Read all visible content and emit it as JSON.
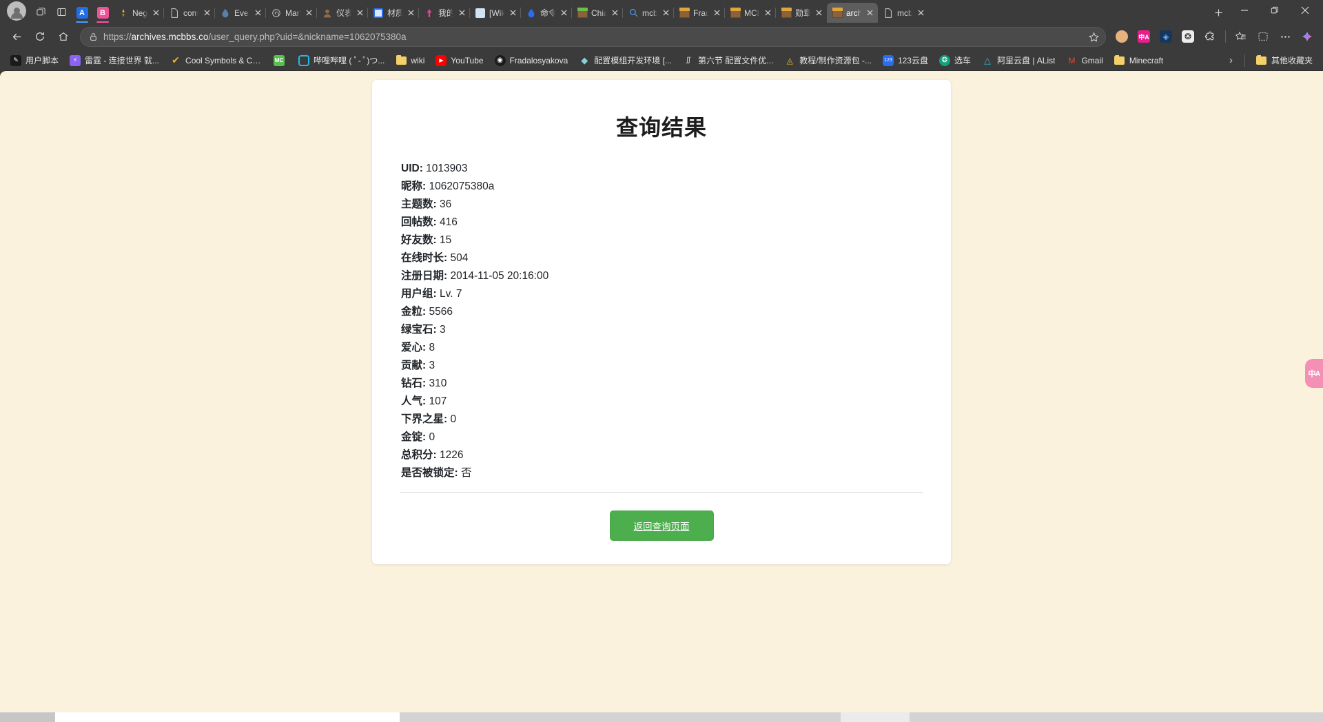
{
  "browser": {
    "window_controls": {
      "minimize": "—",
      "maximize": "❐",
      "close": "✕"
    },
    "new_tab_label": "+",
    "pinned_tabs": [
      {
        "name": "pinned-tab-a",
        "letter": "A",
        "color": "#1f6feb",
        "underline": "#4a9eff"
      },
      {
        "name": "pinned-tab-b",
        "letter": "B",
        "color": "#f0519a",
        "underline": "#ff4fa3"
      }
    ],
    "tabs": [
      {
        "title": "Negati",
        "icon": "compass-icon",
        "active": false
      },
      {
        "title": "com.p",
        "icon": "document-icon",
        "active": false
      },
      {
        "title": "Event",
        "icon": "droplet-icon",
        "active": false
      },
      {
        "title": "Marke",
        "icon": "spiral-icon",
        "active": false
      },
      {
        "title": "仪表盘",
        "icon": "person-icon",
        "active": false
      },
      {
        "title": "材质",
        "icon": "blue-square-icon",
        "active": false
      },
      {
        "title": "我的世",
        "icon": "pink-arrow-icon",
        "active": false
      },
      {
        "title": "[Wiki]",
        "icon": "wiki-icon",
        "active": false
      },
      {
        "title": "命令",
        "icon": "blue-droplet-icon",
        "active": false
      },
      {
        "title": "Chiang",
        "icon": "grass-block-icon",
        "active": false
      },
      {
        "title": "mcbbs",
        "icon": "search-icon",
        "active": false
      },
      {
        "title": "Frada",
        "icon": "dirt-block-icon",
        "active": false
      },
      {
        "title": "MCBB",
        "icon": "dirt-block-icon",
        "active": false
      },
      {
        "title": "勋章惨",
        "icon": "dirt-block-icon",
        "active": false
      },
      {
        "title": "archive",
        "icon": "dirt-block-icon",
        "active": true
      },
      {
        "title": "mcbbs",
        "icon": "document-icon",
        "active": false
      }
    ],
    "nav": {
      "back": "back-arrow",
      "refresh": "refresh-arrow",
      "home": "home-icon",
      "url_prefix": "https://",
      "url_domain": "archives.mcbbs.co",
      "url_path": "/user_query.php?uid=&nickname=1062075380a",
      "url_full": "https://archives.mcbbs.co/user_query.php?uid=&nickname=1062075380a",
      "lock": "lock-icon",
      "star": "favorite-star-icon"
    },
    "toolbar_icons": [
      {
        "name": "profile-face-icon",
        "glyph": "◕",
        "color": "#e8b27e"
      },
      {
        "name": "translate-icon",
        "glyph": "中A",
        "color": "#e91e8c"
      },
      {
        "name": "copilot-page-icon",
        "glyph": "◈",
        "color": "#2b5ea8"
      },
      {
        "name": "openai-icon",
        "glyph": "❂",
        "color": "#e8e8e8"
      },
      {
        "name": "extensions-icon",
        "glyph": "⧉",
        "color": "#dcdcdc"
      },
      {
        "name": "collections-icon",
        "glyph": "☆",
        "color": "#dcdcdc"
      },
      {
        "name": "split-screen-icon",
        "glyph": "⊠",
        "color": "#dcdcdc"
      },
      {
        "name": "settings-more-icon",
        "glyph": "⋯",
        "color": "#dcdcdc"
      },
      {
        "name": "copilot-icon",
        "glyph": "✦",
        "color": "#7cc6f7"
      }
    ],
    "bookmarks": [
      {
        "label": "用户脚本",
        "icon": "tampermonkey-icon",
        "color": "#1b1b1b"
      },
      {
        "label": "雷霆 - 连接世界 就...",
        "icon": "thunder-icon",
        "color": "#8a64f0"
      },
      {
        "label": "Cool Symbols & Co...",
        "icon": "check-icon",
        "color": "#f0b429"
      },
      {
        "label": "",
        "icon": "mc-icon",
        "color": "#5bbf4f"
      },
      {
        "label": "哔哩哔哩 ( ﾟ- ﾟ)つ...",
        "icon": "bilibili-icon",
        "color": "#22bbe8"
      },
      {
        "label": "wiki",
        "icon": "folder-icon",
        "color": "#f4d06a"
      },
      {
        "label": "YouTube",
        "icon": "youtube-icon",
        "color": "#ff0000"
      },
      {
        "label": "Fradalosyakova",
        "icon": "circle-icon",
        "color": "#1b1b1b"
      },
      {
        "label": "配置模组开发环境 [...",
        "icon": "diamond-icon",
        "color": "#8ad0d8"
      },
      {
        "label": "第六节 配置文件优...",
        "icon": "nn-icon",
        "color": "#dcdcdc"
      },
      {
        "label": "教程/制作资源包 -...",
        "icon": "palette-icon",
        "color": "#f0b429"
      },
      {
        "label": "123云盘",
        "icon": "cloud123-icon",
        "color": "#2a6df0"
      },
      {
        "label": "选车",
        "icon": "openai-icon",
        "color": "#10a37f"
      },
      {
        "label": "阿里云盘 | AList",
        "icon": "alist-icon",
        "color": "#36b0c9"
      },
      {
        "label": "Gmail",
        "icon": "gmail-icon",
        "color": "#ea4335"
      },
      {
        "label": "Minecraft",
        "icon": "folder-icon",
        "color": "#f4d06a"
      }
    ],
    "bookmarks_overflow": {
      "chevron": "›",
      "label": "其他收藏夹",
      "icon": "folder-icon"
    }
  },
  "page": {
    "title": "查询结果",
    "fields": [
      {
        "key": "UID",
        "value": "1013903"
      },
      {
        "key": "昵称",
        "value": "1062075380a"
      },
      {
        "key": "主题数",
        "value": "36"
      },
      {
        "key": "回帖数",
        "value": "416"
      },
      {
        "key": "好友数",
        "value": "15"
      },
      {
        "key": "在线时长",
        "value": "504"
      },
      {
        "key": "注册日期",
        "value": "2014-11-05 20:16:00"
      },
      {
        "key": "用户组",
        "value": "Lv. 7"
      },
      {
        "key": "金粒",
        "value": "5566"
      },
      {
        "key": "绿宝石",
        "value": "3"
      },
      {
        "key": "爱心",
        "value": "8"
      },
      {
        "key": "贡献",
        "value": "3"
      },
      {
        "key": "钻石",
        "value": "310"
      },
      {
        "key": "人气",
        "value": "107"
      },
      {
        "key": "下界之星",
        "value": "0"
      },
      {
        "key": "金锭",
        "value": "0"
      },
      {
        "key": "总积分",
        "value": "1226"
      },
      {
        "key": "是否被锁定",
        "value": "否"
      }
    ],
    "back_button": "返回查询页面",
    "translate_widget": "中A",
    "colors": {
      "page_background": "#fbf2dd",
      "card_background": "#ffffff",
      "button_green": "#4cae4c",
      "text": "#212529"
    }
  }
}
